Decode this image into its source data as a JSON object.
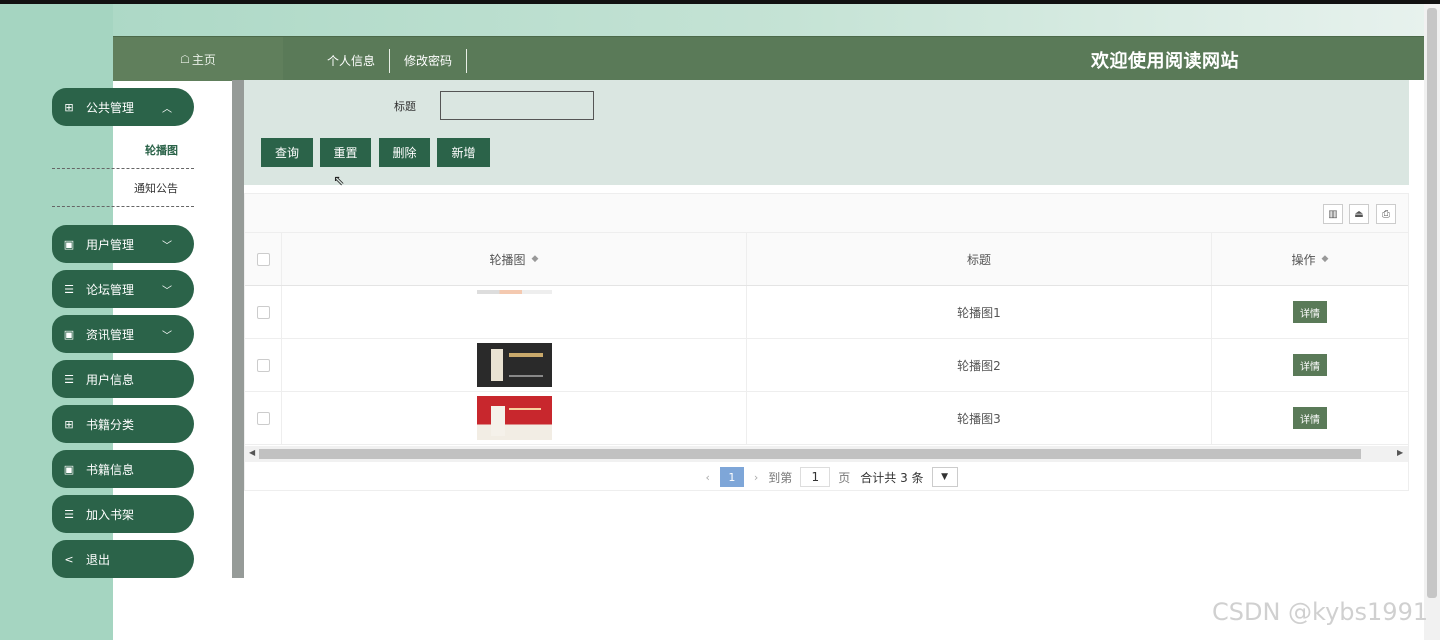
{
  "header": {
    "home_label": "主页",
    "home_icon": "home-icon",
    "nav": [
      "个人信息",
      "修改密码"
    ],
    "site_title": "欢迎使用阅读网站"
  },
  "sidebar": {
    "groups": [
      {
        "label": "公共管理",
        "icon": "grid-icon",
        "chevron": "up",
        "children": [
          "轮播图",
          "通知公告"
        ],
        "active_child": "轮播图"
      },
      {
        "label": "用户管理",
        "icon": "book-icon",
        "chevron": "down"
      },
      {
        "label": "论坛管理",
        "icon": "list-icon",
        "chevron": "down"
      },
      {
        "label": "资讯管理",
        "icon": "book-icon",
        "chevron": "down"
      },
      {
        "label": "用户信息",
        "icon": "list-icon"
      },
      {
        "label": "书籍分类",
        "icon": "grid-icon"
      },
      {
        "label": "书籍信息",
        "icon": "book-icon"
      },
      {
        "label": "加入书架",
        "icon": "list-icon"
      },
      {
        "label": "退出",
        "icon": "share-icon"
      }
    ]
  },
  "search": {
    "title_label": "标题",
    "title_value": "",
    "buttons": [
      "查询",
      "重置",
      "删除",
      "新增"
    ]
  },
  "table": {
    "toolbar_icons": [
      "columns-icon",
      "export-icon",
      "print-icon"
    ],
    "columns": [
      "轮播图",
      "标题",
      "操作"
    ],
    "rows": [
      {
        "image": "banner-1",
        "title": "轮播图1",
        "action": "详情"
      },
      {
        "image": "banner-2",
        "title": "轮播图2",
        "action": "详情"
      },
      {
        "image": "banner-3",
        "title": "轮播图3",
        "action": "详情"
      }
    ]
  },
  "pager": {
    "current_page": "1",
    "goto_label": "到第",
    "goto_value": "1",
    "page_unit": "页",
    "total_text": "合计共 3 条"
  },
  "watermark": "CSDN @kybs1991"
}
